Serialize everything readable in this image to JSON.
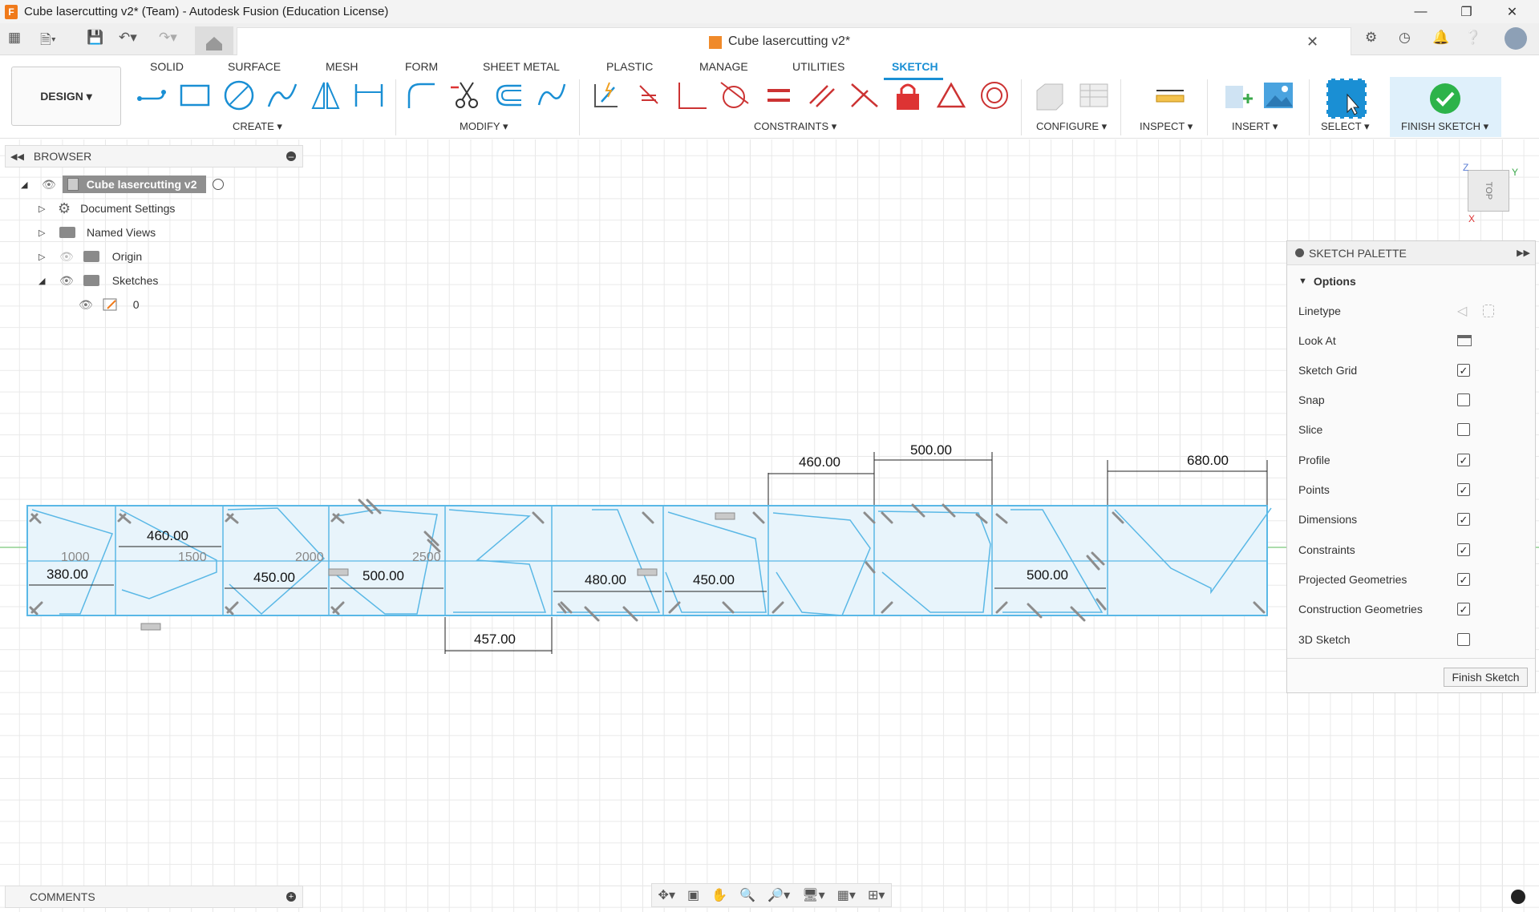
{
  "window": {
    "title": "Cube lasercutting v2* (Team) - Autodesk Fusion (Education License)",
    "app_icon_letter": "F"
  },
  "document_tab": {
    "label": "Cube lasercutting v2*"
  },
  "ribbon": {
    "workspace": "DESIGN",
    "tabs": [
      "SOLID",
      "SURFACE",
      "MESH",
      "FORM",
      "SHEET METAL",
      "PLASTIC",
      "MANAGE",
      "UTILITIES",
      "SKETCH"
    ],
    "active_tab": "SKETCH",
    "groups": {
      "create": "CREATE",
      "modify": "MODIFY",
      "constraints": "CONSTRAINTS",
      "configure": "CONFIGURE",
      "inspect": "INSPECT",
      "insert": "INSERT",
      "select": "SELECT",
      "finish": "FINISH SKETCH"
    }
  },
  "browser": {
    "title": "BROWSER",
    "root": "Cube lasercutting v2",
    "items": [
      "Document Settings",
      "Named Views",
      "Origin",
      "Sketches"
    ],
    "sketch_child": "0"
  },
  "sketch_palette": {
    "title": "SKETCH PALETTE",
    "section": "Options",
    "options": [
      {
        "label": "Linetype",
        "type": "icons"
      },
      {
        "label": "Look At",
        "type": "icon"
      },
      {
        "label": "Sketch Grid",
        "checked": true
      },
      {
        "label": "Snap",
        "checked": false
      },
      {
        "label": "Slice",
        "checked": false
      },
      {
        "label": "Profile",
        "checked": true
      },
      {
        "label": "Points",
        "checked": true
      },
      {
        "label": "Dimensions",
        "checked": true
      },
      {
        "label": "Constraints",
        "checked": true
      },
      {
        "label": "Projected Geometries",
        "checked": true
      },
      {
        "label": "Construction Geometries",
        "checked": true
      },
      {
        "label": "3D Sketch",
        "checked": false
      }
    ],
    "finish_button": "Finish Sketch"
  },
  "sketch": {
    "dimensions": {
      "d460_top": "460.00",
      "d500_top": "500.00",
      "d680_top": "680.00",
      "d460_in": "460.00",
      "d380": "380.00",
      "d450_a": "450.00",
      "d500_a": "500.00",
      "d480": "480.00",
      "d450_b": "450.00",
      "d500_b": "500.00",
      "d457": "457.00"
    },
    "grid_labels": [
      "1000",
      "1500",
      "2000",
      "2500"
    ]
  },
  "viewcube": {
    "face": "TOP",
    "axis_z": "Z",
    "axis_y": "Y",
    "axis_x": "X"
  },
  "comments": {
    "title": "COMMENTS"
  },
  "colors": {
    "accent": "#1a8fd4",
    "sketch_line": "#5ab8e6",
    "profile_fill": "#e8f4fb",
    "finish_check": "#2db34a"
  }
}
